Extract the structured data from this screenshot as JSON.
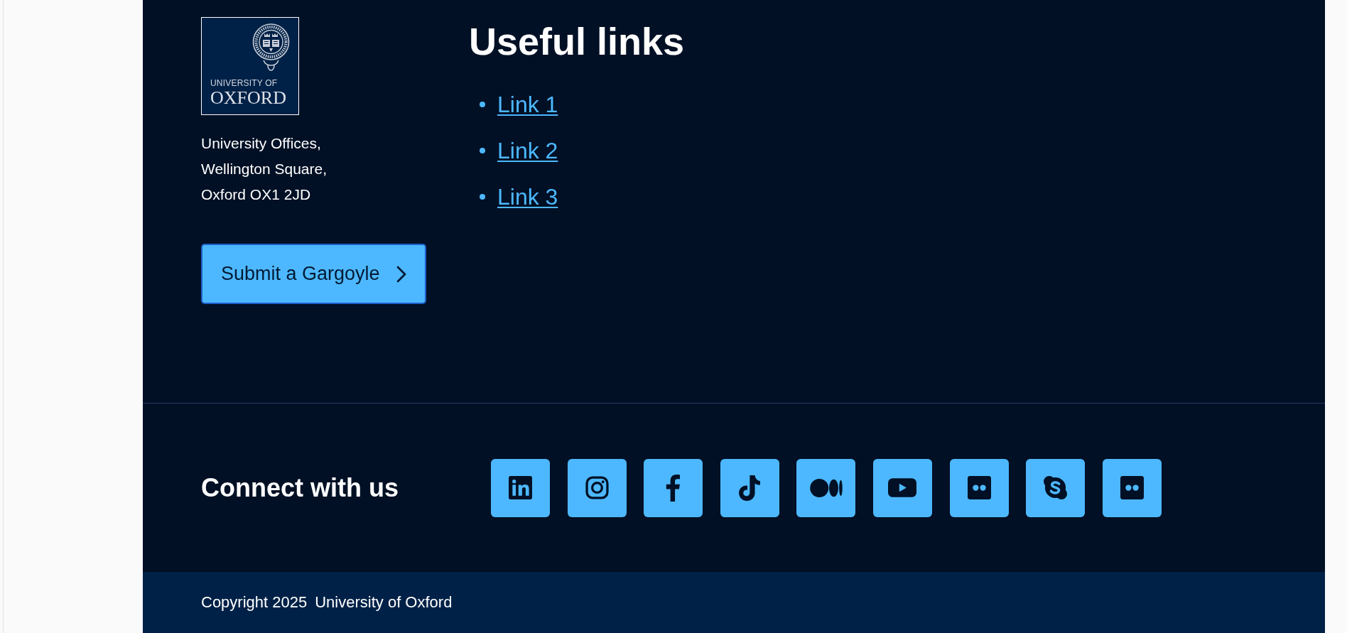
{
  "footer": {
    "logo": {
      "line_1": "UNIVERSITY OF",
      "line_2": "OXFORD"
    },
    "address": [
      "University Offices,",
      "Wellington Square,",
      "Oxford OX1 2JD"
    ],
    "button": {
      "label": "Submit a Gargoyle"
    },
    "useful_links": {
      "title": "Useful links",
      "links": [
        {
          "label": "Link 1"
        },
        {
          "label": "Link 2"
        },
        {
          "label": "Link 3"
        }
      ]
    },
    "connect": {
      "title": "Connect with us",
      "social": [
        {
          "kind": "linkedin"
        },
        {
          "kind": "instagram"
        },
        {
          "kind": "facebook"
        },
        {
          "kind": "tiktok"
        },
        {
          "kind": "medium"
        },
        {
          "kind": "youtube"
        },
        {
          "kind": "flickr"
        },
        {
          "kind": "skype"
        },
        {
          "kind": "flickr"
        }
      ]
    },
    "copyright": {
      "text": "Copyright 2025",
      "owner": "University of Oxford"
    }
  }
}
